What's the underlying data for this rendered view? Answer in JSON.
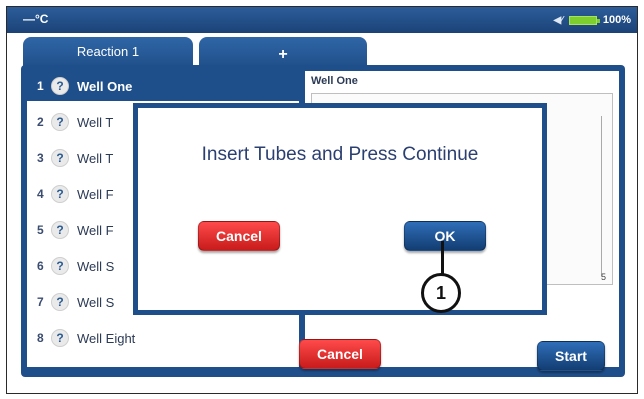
{
  "status": {
    "temperature": "—°C",
    "battery_percent": "100%"
  },
  "tabs": [
    {
      "label": "Reaction 1"
    },
    {
      "label": "+"
    }
  ],
  "wells": [
    {
      "num": "1",
      "name": "Well One"
    },
    {
      "num": "2",
      "name": "Well T"
    },
    {
      "num": "3",
      "name": "Well T"
    },
    {
      "num": "4",
      "name": "Well F"
    },
    {
      "num": "5",
      "name": "Well F"
    },
    {
      "num": "6",
      "name": "Well S"
    },
    {
      "num": "7",
      "name": "Well S"
    },
    {
      "num": "8",
      "name": "Well Eight"
    }
  ],
  "right_pane": {
    "title": "Well One",
    "axis_label": "5"
  },
  "buttons": {
    "main_cancel": "Cancel",
    "start": "Start"
  },
  "dialog": {
    "message": "Insert Tubes and Press Continue",
    "cancel": "Cancel",
    "ok": "OK"
  },
  "callout": {
    "label": "1"
  },
  "colors": {
    "accent_blue": "#1f4f8a",
    "cancel_red": "#e02828",
    "battery_green": "#7ccf2e"
  }
}
